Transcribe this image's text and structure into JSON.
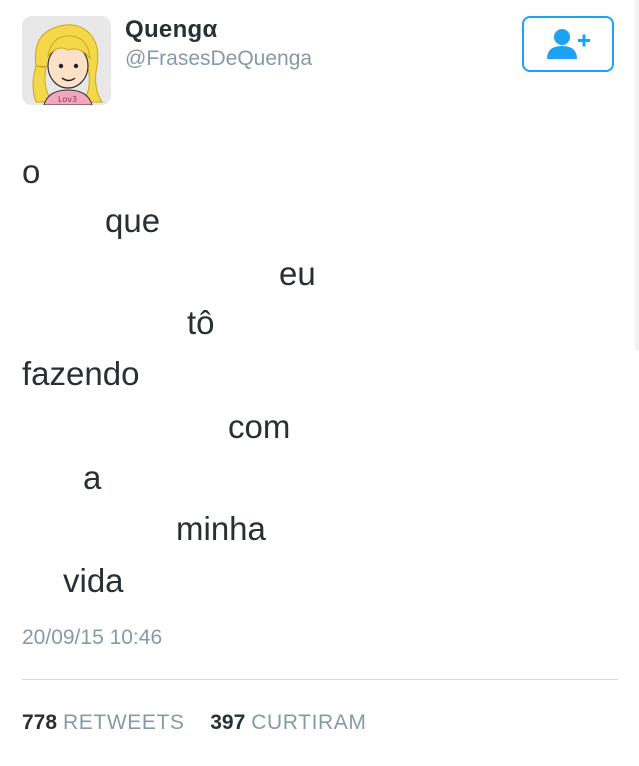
{
  "author": {
    "display_name": "Quengα",
    "handle": "@FrasesDeQuenga",
    "avatar_text": "Lov3"
  },
  "follow_button": {
    "icon": "add-user-icon",
    "color": "#1da1f2"
  },
  "tweet": {
    "words": [
      "o",
      "que",
      "eu",
      "tô",
      "fazendo",
      "com",
      "a",
      "minha",
      "vida"
    ],
    "timestamp": "20/09/15 10:46"
  },
  "stats": {
    "retweets_count": "778",
    "retweets_label": "RETWEETS",
    "likes_count": "397",
    "likes_label": "CURTIRAM"
  }
}
